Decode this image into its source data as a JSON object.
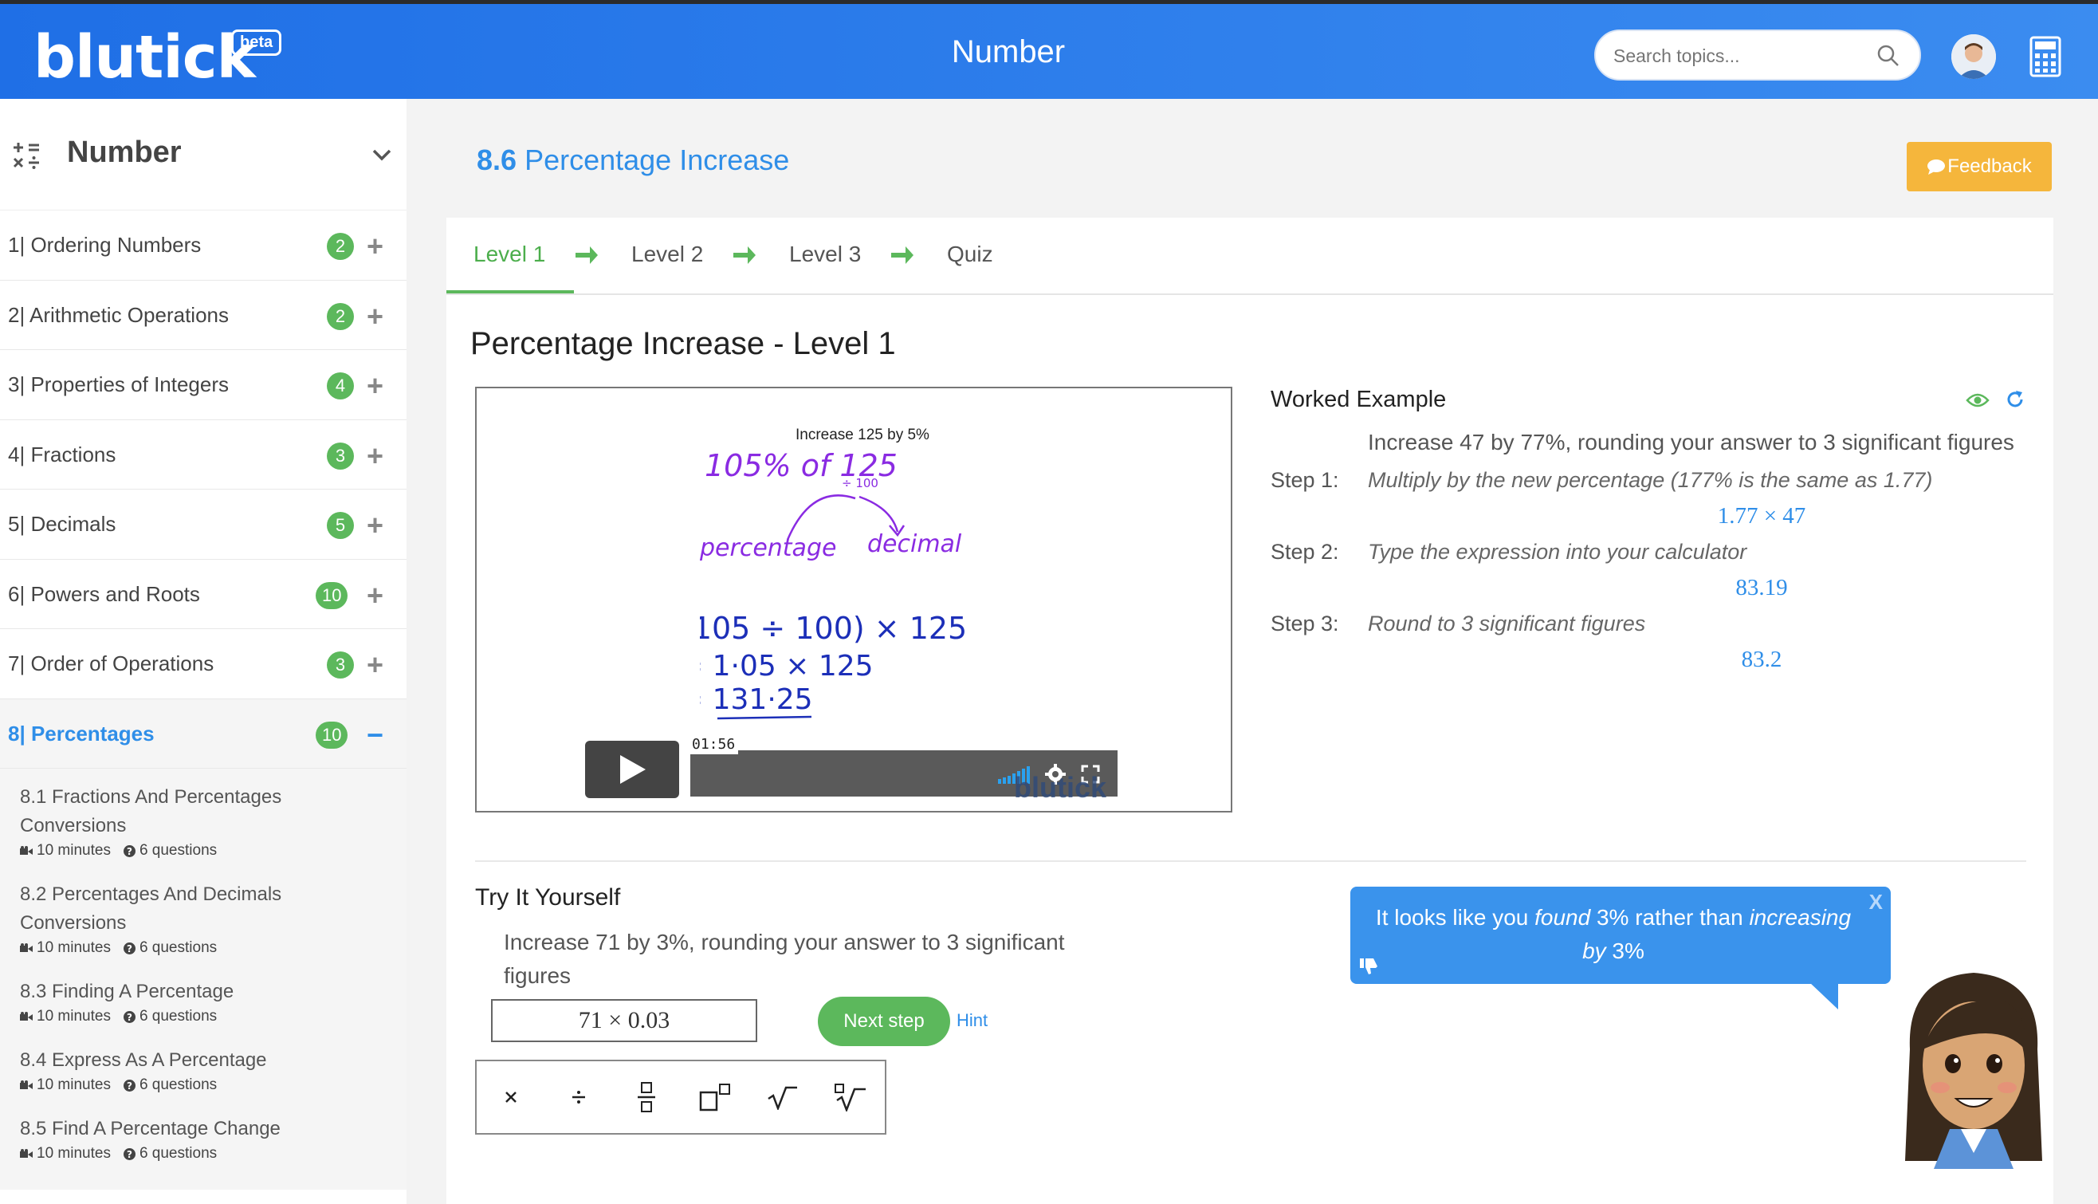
{
  "header": {
    "logo": "blutick",
    "beta": "beta",
    "title": "Number",
    "search_placeholder": "Search topics..."
  },
  "sidebar": {
    "title": "Number",
    "topics": [
      {
        "label": "1| Ordering Numbers",
        "count": "2"
      },
      {
        "label": "2| Arithmetic Operations",
        "count": "2"
      },
      {
        "label": "3| Properties of Integers",
        "count": "4"
      },
      {
        "label": "4| Fractions",
        "count": "3"
      },
      {
        "label": "5| Decimals",
        "count": "5"
      },
      {
        "label": "6| Powers and Roots",
        "count": "10"
      },
      {
        "label": "7| Order of Operations",
        "count": "3"
      },
      {
        "label": "8| Percentages",
        "count": "10"
      }
    ],
    "subtopics": [
      {
        "label": "8.1 Fractions And Percentages Conversions",
        "minutes": "10 minutes",
        "questions": "6 questions"
      },
      {
        "label": "8.2 Percentages And Decimals Conversions",
        "minutes": "10 minutes",
        "questions": "6 questions"
      },
      {
        "label": "8.3 Finding A Percentage",
        "minutes": "10 minutes",
        "questions": "6 questions"
      },
      {
        "label": "8.4 Express As A Percentage",
        "minutes": "10 minutes",
        "questions": "6 questions"
      },
      {
        "label": "8.5 Find A Percentage Change",
        "minutes": "10 minutes",
        "questions": "6 questions"
      }
    ]
  },
  "lesson": {
    "number": "8.6",
    "title": "Percentage Increase",
    "feedback": "Feedback",
    "tabs": [
      "Level 1",
      "Level 2",
      "Level 3",
      "Quiz"
    ],
    "level_title": "Percentage Increase - Level 1"
  },
  "video": {
    "caption": "Increase 125 by 5%",
    "line1": "105% of 125",
    "small": "÷ 100",
    "word1": "percentage",
    "word2": "decimal",
    "eq1": "(105 ÷ 100) × 125",
    "eq2": "= 1·05 × 125",
    "eq3": "= 131·25",
    "time": "01:56",
    "watermark": "blutick"
  },
  "worked_example": {
    "title": "Worked Example",
    "question": "Increase 47 by 77%, rounding your answer to 3 significant figures",
    "steps": [
      {
        "label": "Step 1:",
        "text": "Multiply by the new percentage (177% is the same as 1.77)",
        "value": "1.77 × 47"
      },
      {
        "label": "Step 2:",
        "text": "Type the expression into your calculator",
        "value": "83.19"
      },
      {
        "label": "Step 3:",
        "text": "Round to 3 significant figures",
        "value": "83.2"
      }
    ]
  },
  "try": {
    "title": "Try It Yourself",
    "question": "Increase 71 by 3%, rounding your answer to 3 significant figures",
    "answer": "71 × 0.03",
    "next": "Next step",
    "hint": "Hint"
  },
  "bubble": {
    "pre": "It looks like you ",
    "found": "found",
    "mid": " 3% rather than ",
    "increasing": "increasing",
    "by": "by",
    "post": " 3%",
    "close": "X"
  }
}
